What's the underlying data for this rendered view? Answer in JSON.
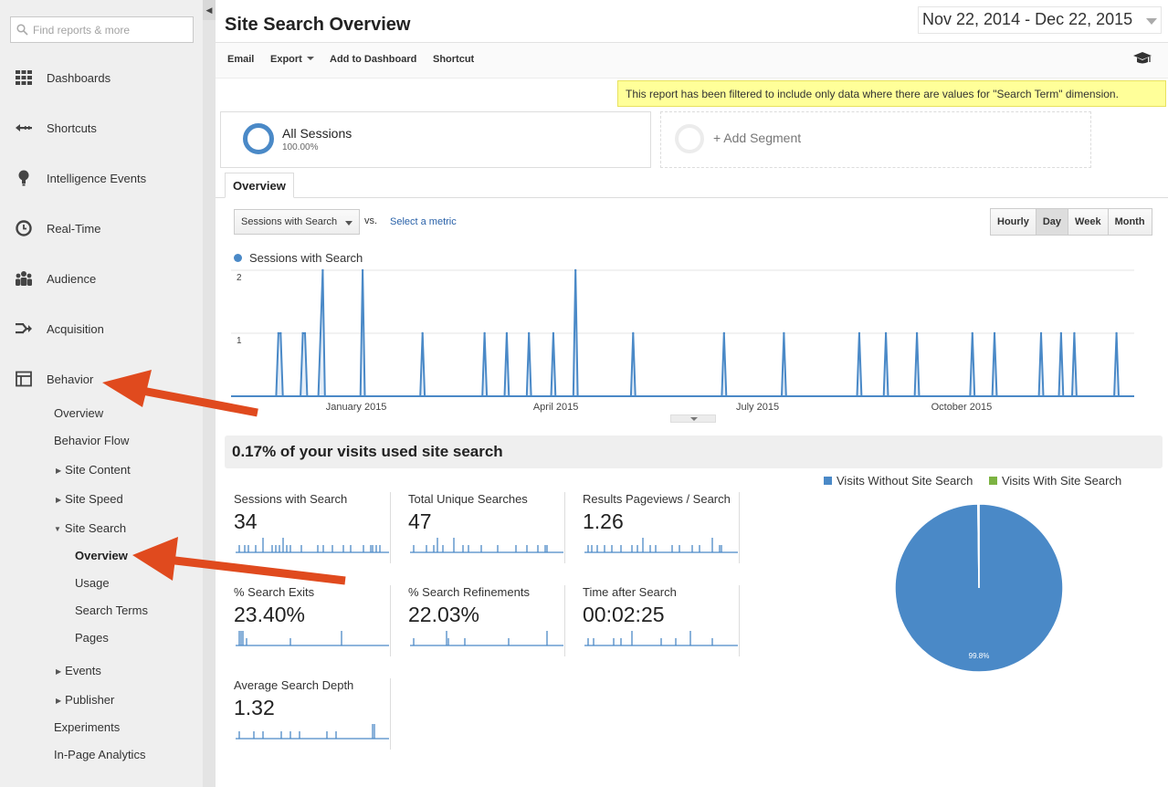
{
  "sidebar": {
    "search_placeholder": "Find reports & more",
    "nav": [
      {
        "label": "Dashboards",
        "icon": "dashboards-icon"
      },
      {
        "label": "Shortcuts",
        "icon": "shortcuts-icon"
      },
      {
        "label": "Intelligence Events",
        "icon": "lightbulb-icon"
      },
      {
        "label": "Real-Time",
        "icon": "clock-icon"
      },
      {
        "label": "Audience",
        "icon": "people-icon"
      },
      {
        "label": "Acquisition",
        "icon": "acquisition-icon"
      },
      {
        "label": "Behavior",
        "icon": "behavior-icon"
      }
    ],
    "behavior_sub": {
      "overview": "Overview",
      "behavior_flow": "Behavior Flow",
      "site_content": "Site Content",
      "site_speed": "Site Speed",
      "site_search": "Site Search",
      "site_search_children": [
        "Overview",
        "Usage",
        "Search Terms",
        "Pages"
      ],
      "events": "Events",
      "publisher": "Publisher",
      "experiments": "Experiments",
      "in_page_analytics": "In-Page Analytics"
    }
  },
  "header": {
    "title": "Site Search Overview",
    "date_range": "Nov 22, 2014 - Dec 22, 2015"
  },
  "toolbar": {
    "email": "Email",
    "export": "Export",
    "add_to_dashboard": "Add to Dashboard",
    "shortcut": "Shortcut"
  },
  "filter_note": "This report has been filtered to include only data where there are values for \"Search Term\" dimension.",
  "segments": {
    "all_sessions": "All Sessions",
    "all_sessions_pct": "100.00%",
    "add_segment": "+ Add Segment"
  },
  "tabs": {
    "overview": "Overview"
  },
  "chart_controls": {
    "metric": "Sessions with Search",
    "vs": "vs.",
    "select_metric": "Select a metric",
    "granularity": [
      "Hourly",
      "Day",
      "Week",
      "Month"
    ],
    "active_granularity": "Day"
  },
  "colors": {
    "series": "#4a89c7",
    "with_search": "#7cb342",
    "arrow": "#e04a1e"
  },
  "chart_data": [
    {
      "type": "line",
      "series": [
        {
          "name": "Sessions with Search",
          "points": [
            [
              "2014-12-01",
              1
            ],
            [
              "2014-12-02",
              1
            ],
            [
              "2014-12-12",
              1
            ],
            [
              "2014-12-13",
              1
            ],
            [
              "2014-12-20",
              1
            ],
            [
              "2014-12-21",
              2
            ],
            [
              "2015-01-08",
              2
            ],
            [
              "2015-02-04",
              1
            ],
            [
              "2015-03-04",
              1
            ],
            [
              "2015-03-14",
              1
            ],
            [
              "2015-03-24",
              1
            ],
            [
              "2015-04-04",
              1
            ],
            [
              "2015-04-14",
              2
            ],
            [
              "2015-05-10",
              1
            ],
            [
              "2015-06-20",
              1
            ],
            [
              "2015-07-17",
              1
            ],
            [
              "2015-08-20",
              1
            ],
            [
              "2015-09-01",
              1
            ],
            [
              "2015-09-15",
              1
            ],
            [
              "2015-10-10",
              1
            ],
            [
              "2015-10-20",
              1
            ],
            [
              "2015-11-10",
              1
            ],
            [
              "2015-11-19",
              1
            ],
            [
              "2015-11-25",
              1
            ],
            [
              "2015-12-14",
              1
            ]
          ]
        }
      ],
      "x_range": [
        "2014-11-22",
        "2015-12-22"
      ],
      "x_ticks": [
        "January 2015",
        "April 2015",
        "July 2015",
        "October 2015"
      ],
      "y_ticks": [
        1,
        2
      ],
      "ylim": [
        0,
        2
      ],
      "baseline": 0,
      "grid": true,
      "legend": "top-left"
    },
    {
      "type": "pie",
      "labels": [
        "Visits Without Site Search",
        "Visits With Site Search"
      ],
      "values": [
        99.8,
        0.2
      ],
      "colors": [
        "#4a89c7",
        "#7cb342"
      ],
      "slice_label": "99.8%",
      "legend": "top"
    }
  ],
  "summary": {
    "headline": "0.17% of your visits used site search",
    "metrics": [
      {
        "label": "Sessions with Search",
        "value": "34"
      },
      {
        "label": "Total Unique Searches",
        "value": "47"
      },
      {
        "label": "Results Pageviews / Search",
        "value": "1.26"
      },
      {
        "label": "% Search Exits",
        "value": "23.40%"
      },
      {
        "label": "% Search Refinements",
        "value": "22.03%"
      },
      {
        "label": "Time after Search",
        "value": "00:02:25"
      },
      {
        "label": "Average Search Depth",
        "value": "1.32"
      }
    ]
  }
}
